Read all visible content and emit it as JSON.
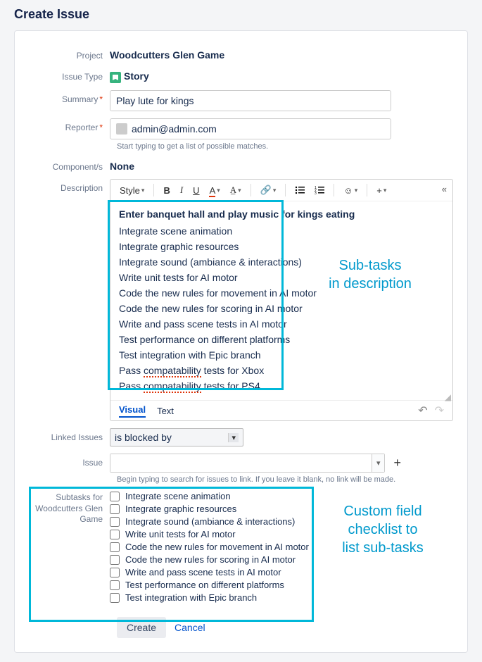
{
  "page_title": "Create Issue",
  "fields": {
    "project": {
      "label": "Project",
      "value": "Woodcutters Glen Game"
    },
    "issue_type": {
      "label": "Issue Type",
      "value": "Story"
    },
    "summary": {
      "label": "Summary",
      "required": true,
      "value": "Play lute for kings"
    },
    "reporter": {
      "label": "Reporter",
      "required": true,
      "value": "admin@admin.com",
      "help": "Start typing to get a list of possible matches."
    },
    "components": {
      "label": "Component/s",
      "value": "None"
    },
    "description": {
      "label": "Description"
    },
    "linked_issues": {
      "label": "Linked Issues",
      "selected": "is blocked by"
    },
    "issue": {
      "label": "Issue",
      "help": "Begin typing to search for issues to link. If you leave it blank, no link will be made."
    },
    "subtasks": {
      "label": "Subtasks for Woodcutters Glen Game"
    }
  },
  "editor": {
    "style_label": "Style",
    "heading": "Enter banquet hall and play music for kings eating",
    "lines": [
      "Integrate scene animation",
      "Integrate graphic resources",
      "Integrate sound (ambiance & interactions)",
      "Write unit tests for AI motor",
      "Code the new rules for movement in AI motor",
      "Code the new rules for scoring in AI motor",
      "Write and pass scene tests in AI motor",
      "Test performance on different platforms",
      "Test integration with Epic branch",
      "Pass compatability tests for Xbox",
      "Pass compatability tests for PS4"
    ],
    "tabs": {
      "visual": "Visual",
      "text": "Text"
    }
  },
  "annotations": {
    "desc": "Sub-tasks\nin description",
    "checklist": "Custom field\nchecklist to\nlist sub-tasks"
  },
  "checklist_items": [
    "Integrate scene animation",
    "Integrate graphic resources",
    "Integrate sound (ambiance & interactions)",
    "Write unit tests for AI motor",
    "Code the new rules for movement in AI motor",
    "Code the new rules for scoring in AI motor",
    "Write and pass scene tests in AI motor",
    "Test performance on different platforms",
    "Test integration with Epic branch"
  ],
  "footer": {
    "create": "Create",
    "cancel": "Cancel"
  }
}
